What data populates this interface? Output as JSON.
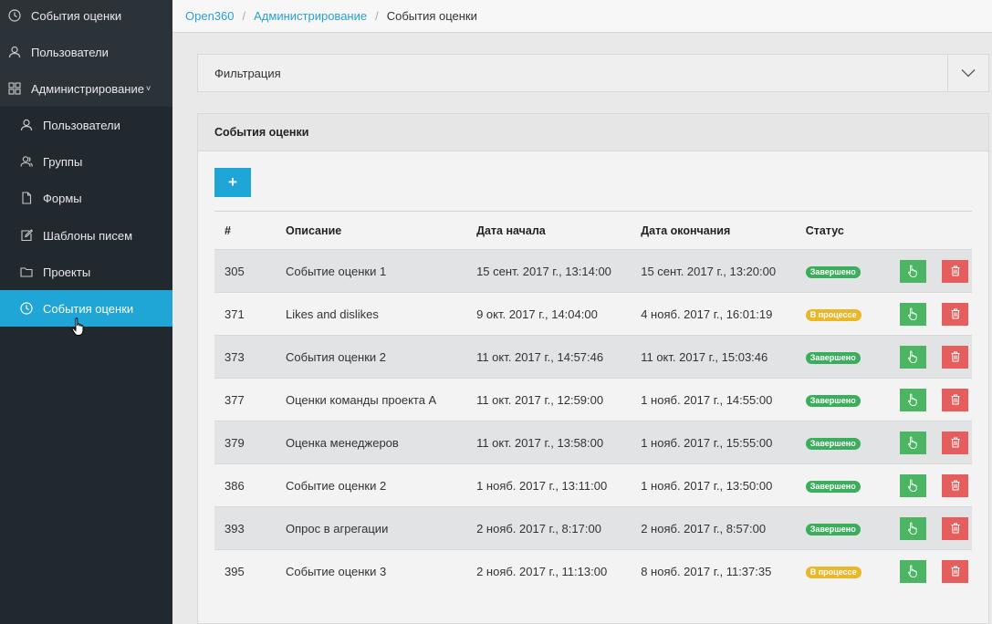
{
  "sidebar": {
    "items": [
      {
        "label": "События оценки",
        "icon": "clock-icon"
      },
      {
        "label": "Пользователи",
        "icon": "user-icon"
      },
      {
        "label": "Администрирование",
        "icon": "grid-icon",
        "caret": "˅"
      },
      {
        "label": "Пользователи",
        "icon": "user-icon"
      },
      {
        "label": "Группы",
        "icon": "users-icon"
      },
      {
        "label": "Формы",
        "icon": "file-icon"
      },
      {
        "label": "Шаблоны писем",
        "icon": "edit-icon"
      },
      {
        "label": "Проекты",
        "icon": "folder-icon"
      },
      {
        "label": "События оценки",
        "icon": "clock-icon",
        "active": true
      }
    ]
  },
  "breadcrumb": {
    "home": "Open360",
    "admin": "Администрирование",
    "current": "События оценки",
    "separator": "/"
  },
  "filter": {
    "title": "Фильтрация"
  },
  "events": {
    "title": "События оценки",
    "add_label": "+",
    "columns": {
      "id": "#",
      "description": "Описание",
      "start": "Дата начала",
      "end": "Дата окончания",
      "status": "Статус"
    },
    "rows": [
      {
        "id": "305",
        "description": "Событие оценки 1",
        "start": "15 сент. 2017 г., 13:14:00",
        "end": "15 сент. 2017 г., 13:20:00",
        "status": "Завершено",
        "status_kind": "done"
      },
      {
        "id": "371",
        "description": "Likes and dislikes",
        "start": "9 окт. 2017 г., 14:04:00",
        "end": "4 нояб. 2017 г., 16:01:19",
        "status": "В процессе",
        "status_kind": "progress"
      },
      {
        "id": "373",
        "description": "События оценки 2",
        "start": "11 окт. 2017 г., 14:57:46",
        "end": "11 окт. 2017 г., 15:03:46",
        "status": "Завершено",
        "status_kind": "done"
      },
      {
        "id": "377",
        "description": "Оценки команды проекта А",
        "start": "11 окт. 2017 г., 12:59:00",
        "end": "1 нояб. 2017 г., 14:55:00",
        "status": "Завершено",
        "status_kind": "done"
      },
      {
        "id": "379",
        "description": "Оценка менеджеров",
        "start": "11 окт. 2017 г., 13:58:00",
        "end": "1 нояб. 2017 г., 15:55:00",
        "status": "Завершено",
        "status_kind": "done"
      },
      {
        "id": "386",
        "description": "Событие оценки 2",
        "start": "1 нояб. 2017 г., 13:11:00",
        "end": "1 нояб. 2017 г., 13:50:00",
        "status": "Завершено",
        "status_kind": "done"
      },
      {
        "id": "393",
        "description": "Опрос в агрегации",
        "start": "2 нояб. 2017 г., 8:17:00",
        "end": "2 нояб. 2017 г., 8:57:00",
        "status": "Завершено",
        "status_kind": "done"
      },
      {
        "id": "395",
        "description": "Событие оценки 3",
        "start": "2 нояб. 2017 г., 11:13:00",
        "end": "8 нояб. 2017 г., 11:37:35",
        "status": "В процессе",
        "status_kind": "progress"
      }
    ]
  },
  "colors": {
    "sidebar_bg": "#22292e",
    "accent": "#1fa5d6",
    "done": "#3aae5b",
    "progress": "#e8b82a",
    "open_button": "#4cb563",
    "delete_button": "#e55d5d"
  }
}
